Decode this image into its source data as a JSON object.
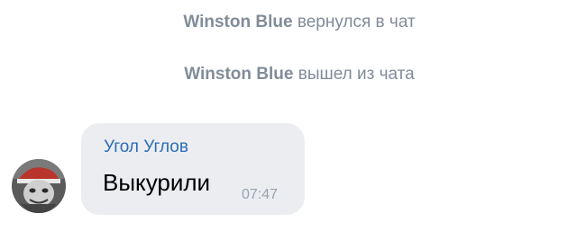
{
  "service_messages": [
    {
      "actor": "Winston Blue",
      "action": "вернулся в чат"
    },
    {
      "actor": "Winston Blue",
      "action": "вышел из чата"
    }
  ],
  "message": {
    "author": "Угол Углов",
    "text": "Выкурили",
    "time": "07:47",
    "avatar_icon": "user-avatar"
  },
  "colors": {
    "service_text": "#818c99",
    "author_name": "#2a6db5",
    "bubble_bg": "#ebedf0",
    "time_text": "#99a2ad"
  }
}
